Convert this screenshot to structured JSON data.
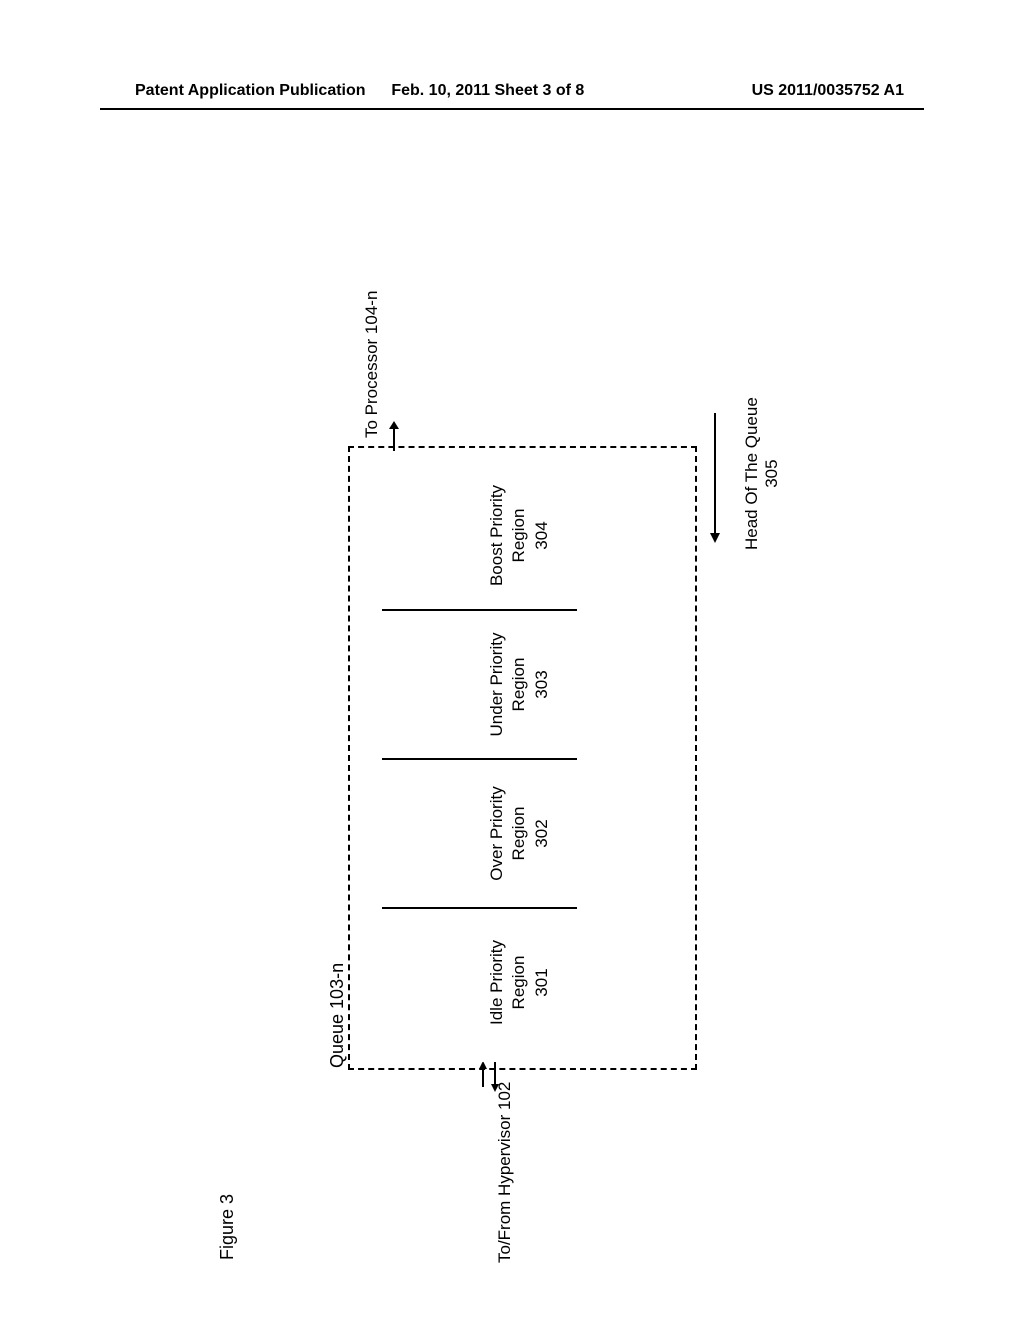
{
  "header": {
    "left": "Patent Application Publication",
    "center": "Feb. 10, 2011  Sheet 3 of 8",
    "right": "US 2011/0035752 A1"
  },
  "figure_label": "Figure 3",
  "queue_label": "Queue 103-n",
  "regions": [
    {
      "l1": "Idle Priority",
      "l2": "Region",
      "l3": "301"
    },
    {
      "l1": "Over Priority",
      "l2": "Region",
      "l3": "302"
    },
    {
      "l1": "Under Priority",
      "l2": "Region",
      "l3": "303"
    },
    {
      "l1": "Boost Priority",
      "l2": "Region",
      "l3": "304"
    }
  ],
  "hypervisor_label": "To/From Hypervisor 102",
  "processor_label": "To Processor 104-n",
  "head_label_l1": "Head Of The Queue",
  "head_label_l2": "305"
}
